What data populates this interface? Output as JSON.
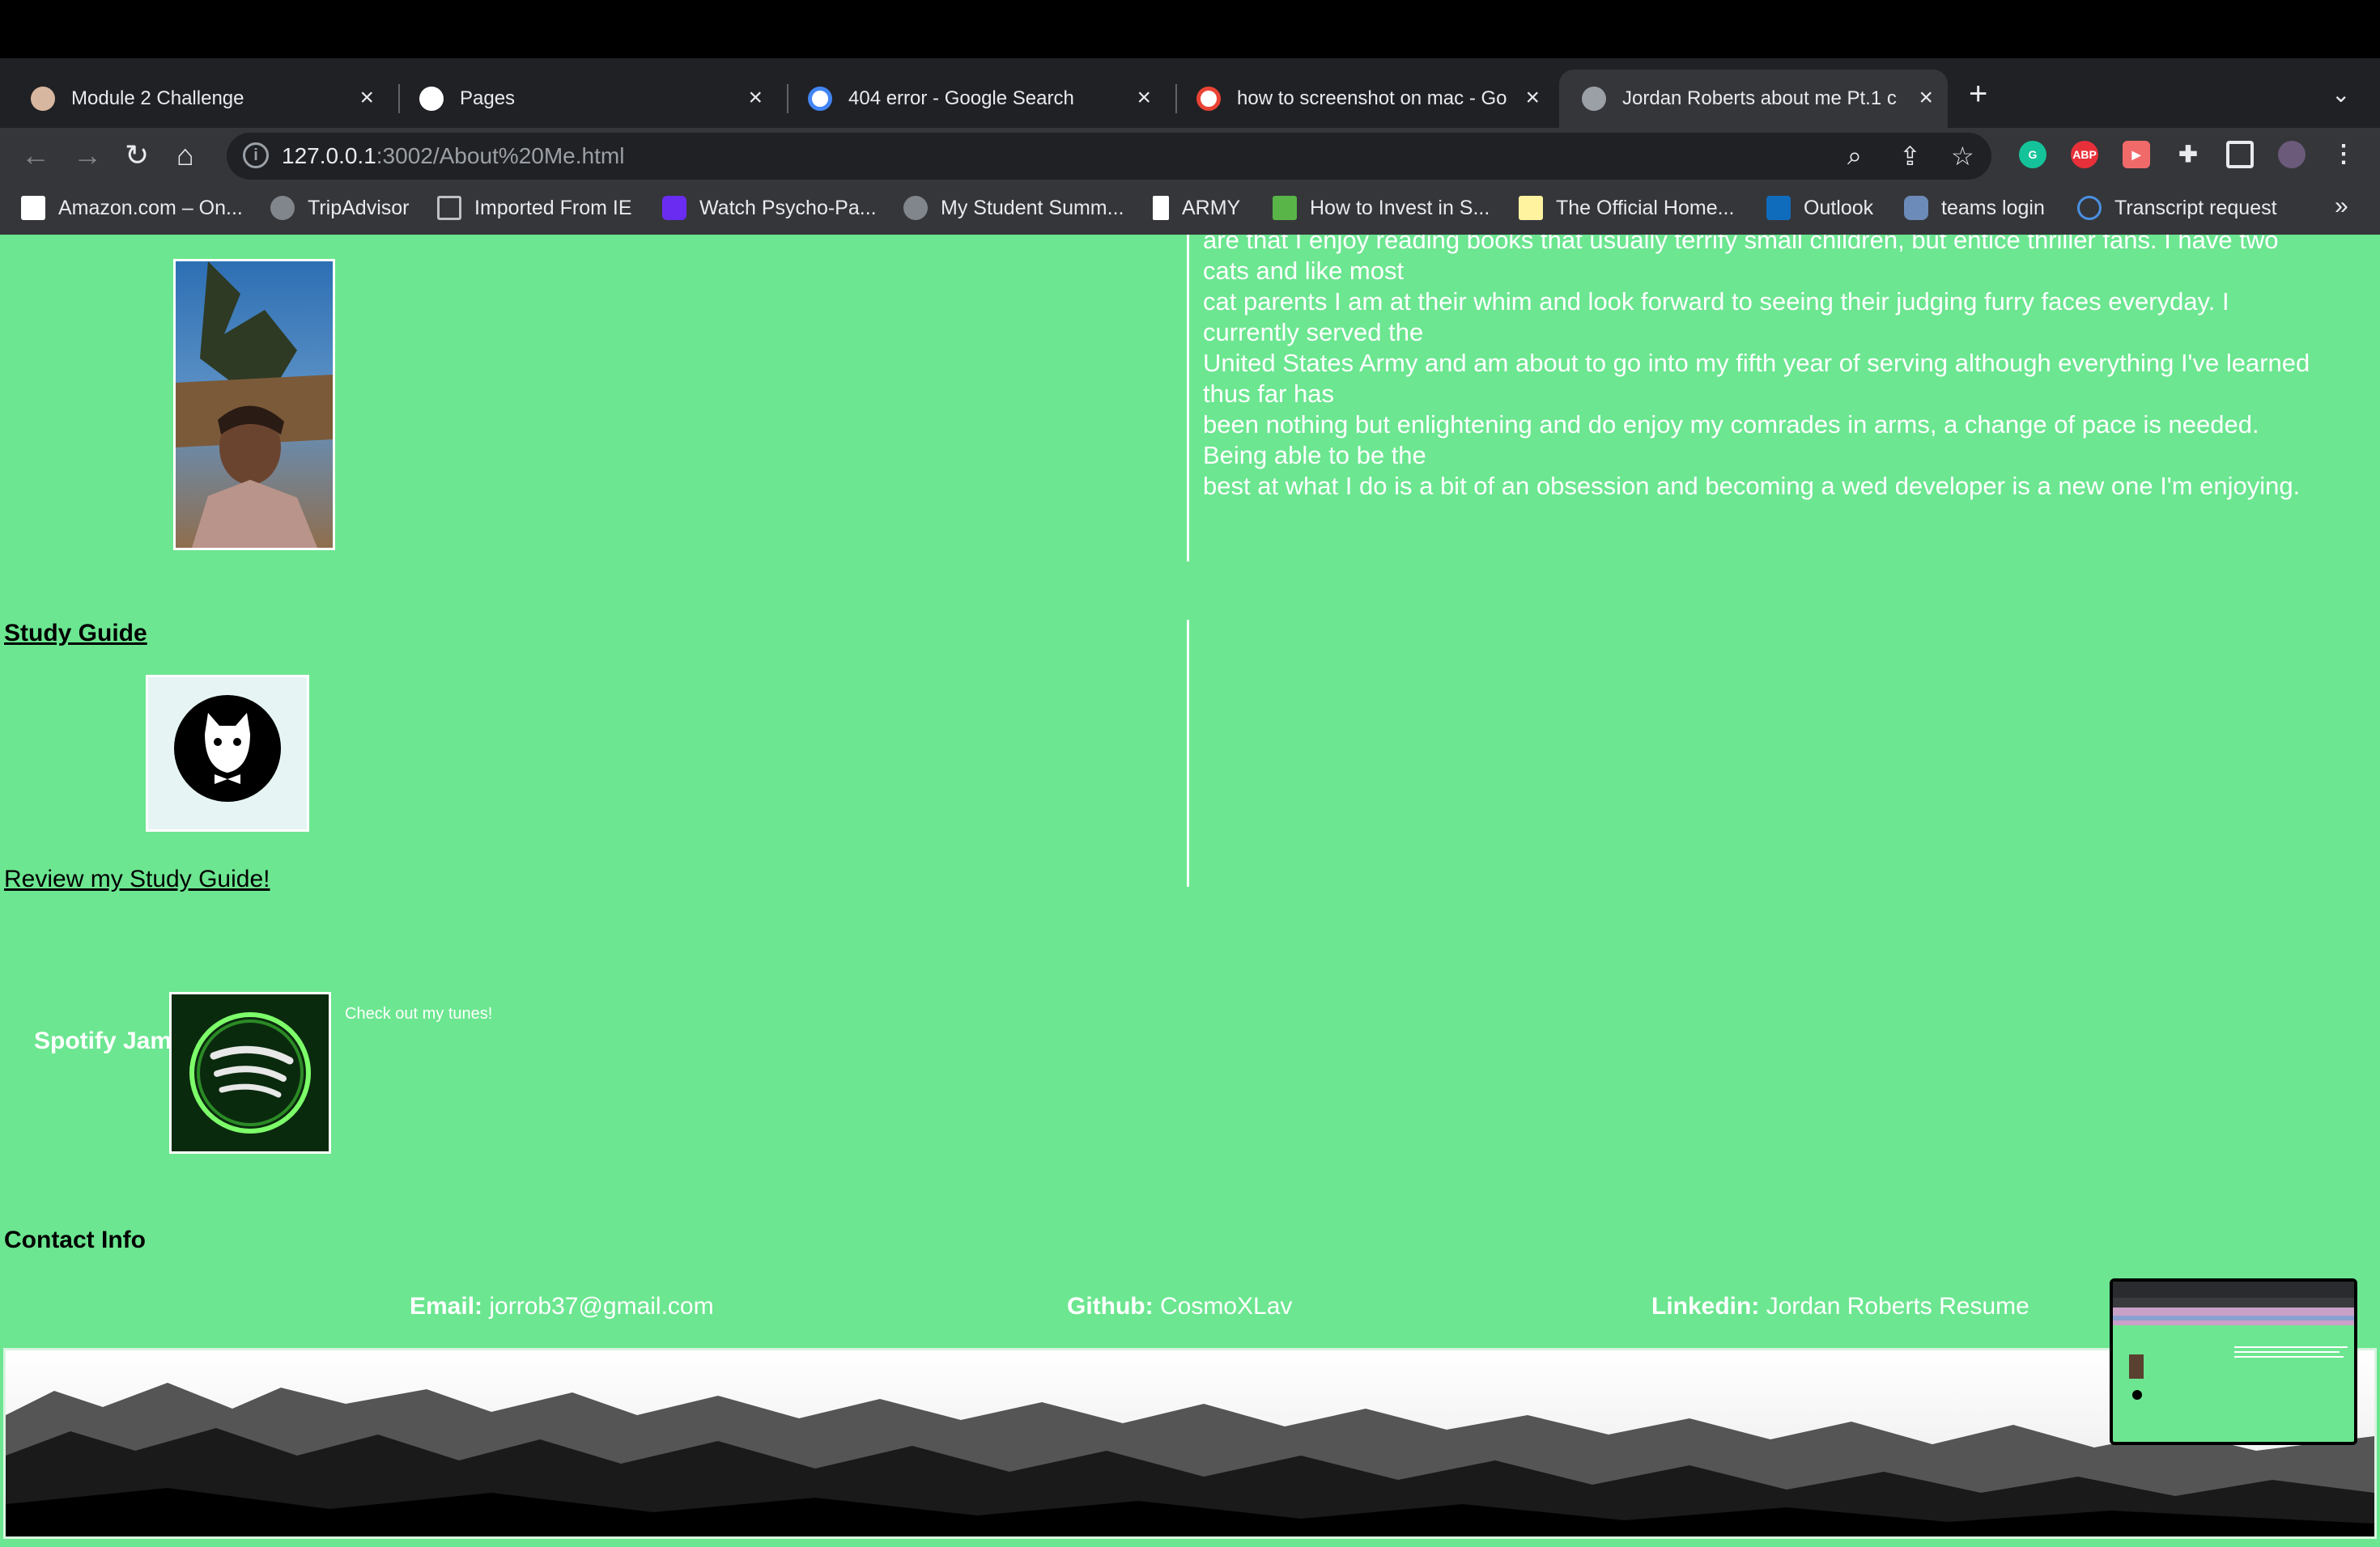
{
  "browser": {
    "tabs": [
      {
        "title": "Module 2 Challenge",
        "active": false
      },
      {
        "title": "Pages",
        "active": false
      },
      {
        "title": "404 error - Google Search",
        "active": false
      },
      {
        "title": "how to screenshot on mac - Go",
        "active": false
      },
      {
        "title": "Jordan Roberts about me Pt.1 c",
        "active": true
      }
    ],
    "new_tab": "+",
    "close": "×",
    "url_host": "127.0.0.1",
    "url_path": ":3002/About%20Me.html",
    "extensions": {
      "abp": "ABP"
    },
    "bookmarks": [
      "Amazon.com – On...",
      "TripAdvisor",
      "Imported From IE",
      "Watch Psycho-Pa...",
      "My Student Summ...",
      "ARMY",
      "How to Invest in S...",
      "The Official Home...",
      "Outlook",
      "teams login",
      "Transcript request"
    ],
    "bookmarks_more": "»"
  },
  "page": {
    "about_lines": [
      "are that I enjoy reading books that usually terrify small children, but entice thriller fans. I have two cats and like most",
      "cat parents I am at their whim and look forward to seeing their judging furry faces everyday. I currently served the",
      "United States Army and am about to go into my fifth year of serving although everything I've learned thus far has",
      "been nothing but enlightening and do enjoy my comrades in arms, a change of pace is needed. Being able to be the",
      "best at what I do is a bit of an obsession and becoming a wed developer is a new one I'm enjoying."
    ],
    "study_guide_heading": "Study Guide",
    "review_link": "Review my Study Guide!",
    "spotify_label": "Spotify Jams",
    "spotify_caption": "Check out my tunes!",
    "contact_heading": "Contact Info",
    "contact": {
      "email_label": "Email:",
      "email_value": "jorrob37@gmail.com",
      "github_label": "Github:",
      "github_value": "CosmoXLav",
      "linkedin_label": "Linkedin:",
      "linkedin_value": "Jordan Roberts Resume"
    }
  },
  "colors": {
    "page_background": "#6ce690",
    "chrome_dark": "#202124",
    "chrome_toolbar": "#35363a"
  }
}
